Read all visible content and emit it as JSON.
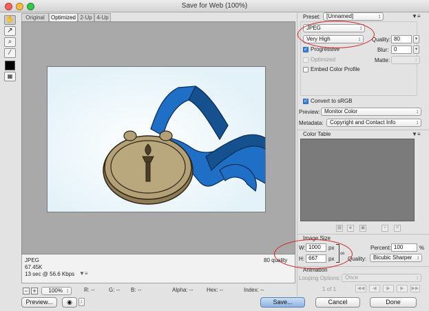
{
  "window": {
    "title": "Save for Web (100%)"
  },
  "tools": [
    {
      "name": "hand-tool",
      "glyph": "✋"
    },
    {
      "name": "slice-select-tool",
      "glyph": "↗"
    },
    {
      "name": "zoom-tool",
      "glyph": "⌕"
    },
    {
      "name": "eyedropper-tool",
      "glyph": "⁄"
    }
  ],
  "tabs": [
    "Original",
    "Optimized",
    "2-Up",
    "4-Up"
  ],
  "preview": {
    "format": "JPEG",
    "size": "67.45K",
    "time": "13 sec @ 56.6 Kbps",
    "quality_text": "80 quality"
  },
  "statusbar": {
    "zoom": "100%",
    "r": "R: --",
    "g": "G: --",
    "b": "B: --",
    "alpha": "Alpha: --",
    "hex": "Hex: --",
    "index": "Index: --"
  },
  "buttons": {
    "preview": "Preview...",
    "save": "Save...",
    "cancel": "Cancel",
    "done": "Done"
  },
  "settings": {
    "preset_label": "Preset:",
    "preset_value": "[Unnamed]",
    "format_value": "JPEG",
    "quality_preset": "Very High",
    "quality_label": "Quality:",
    "quality_value": "80",
    "progressive_label": "Progressive",
    "blur_label": "Blur:",
    "blur_value": "0",
    "optimized_label": "Optimized",
    "matte_label": "Matte:",
    "embed_profile_label": "Embed Color Profile",
    "convert_srgb_label": "Convert to sRGB",
    "preview_label": "Preview:",
    "preview_value": "Monitor Color",
    "metadata_label": "Metadata:",
    "metadata_value": "Copyright and Contact Info"
  },
  "color_table": {
    "title": "Color Table"
  },
  "image_size": {
    "title": "Image Size",
    "w_label": "W:",
    "w_value": "1000",
    "h_label": "H:",
    "h_value": "667",
    "unit": "px",
    "percent_label": "Percent:",
    "percent_value": "100",
    "percent_unit": "%",
    "quality_label": "Quality:",
    "quality_value": "Bicubic Sharper"
  },
  "animation": {
    "title": "Animation",
    "looping_label": "Looping Options:",
    "looping_value": "Once",
    "frame_counter": "1 of 1"
  },
  "colors": {
    "ribbon": "#1f6fc7",
    "ribbon_dark": "#15508f",
    "medal": "#b3a077",
    "medal_dark": "#8f7c55",
    "annotation": "#d22222"
  }
}
